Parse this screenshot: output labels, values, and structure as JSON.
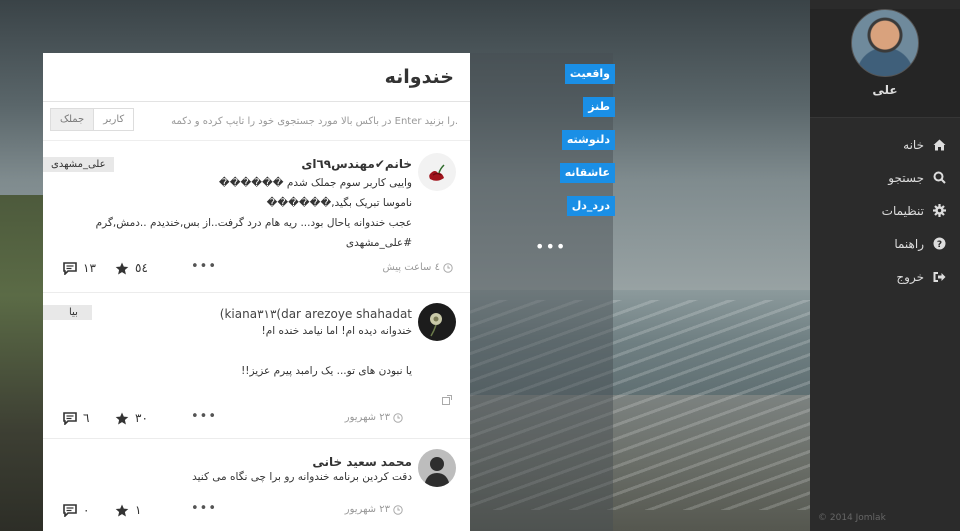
{
  "app": {
    "title": "خندوانه",
    "copyright": "© 2014 Jomlak"
  },
  "search": {
    "hint": "در باکس بالا مورد جستجوی خود را تایپ کرده و دکمه Enter را بزنید.",
    "toggle_user": "کاربر",
    "toggle_post": "جملک"
  },
  "categories": [
    "واقعیت",
    "طنز",
    "دلنوشته",
    "عاشقانه",
    "درد_دل"
  ],
  "sidebar": {
    "user_name": "علی",
    "menu": [
      {
        "label": "خانه",
        "icon": "home-icon"
      },
      {
        "label": "جستجو",
        "icon": "search-icon"
      },
      {
        "label": "تنظیمات",
        "icon": "gear-icon"
      },
      {
        "label": "راهنما",
        "icon": "help-icon"
      },
      {
        "label": "خروج",
        "icon": "logout-icon"
      }
    ]
  },
  "posts": [
    {
      "author": "خانم✔مهندس٦٩ای",
      "badge": "علی_مشهدی",
      "lines": [
        "واییی کاربر سوم جملک شدم ������",
        "ناموسا تبریک بگید,������",
        "عجب خندوانه یاحال بود... ریه هام درد گرفت..از بس,خندیدم ..دمش,گرم",
        "#علی_مشهدی"
      ],
      "comments": "١٣",
      "likes": "٥٤",
      "time": "٤ ساعت پیش"
    },
    {
      "author": "(kiana٣١٣(dar arezoye shahadat",
      "badge": "بیا",
      "lines": [
        "خندوانه دیده ام! اما نیامد خنده ام!",
        "",
        "یا نبودن های تو... یک رامبد پیرم عزیز!!"
      ],
      "comments": "٦",
      "likes": "٣٠",
      "time": "٢٣ شهریور"
    },
    {
      "author": "محمد سعید خانی",
      "badge": "",
      "lines": [
        "دقت کردین برنامه خندوانه رو برا چی نگاه می کنید"
      ],
      "comments": "٠",
      "likes": "١",
      "time": "٢٣ شهریور"
    }
  ]
}
